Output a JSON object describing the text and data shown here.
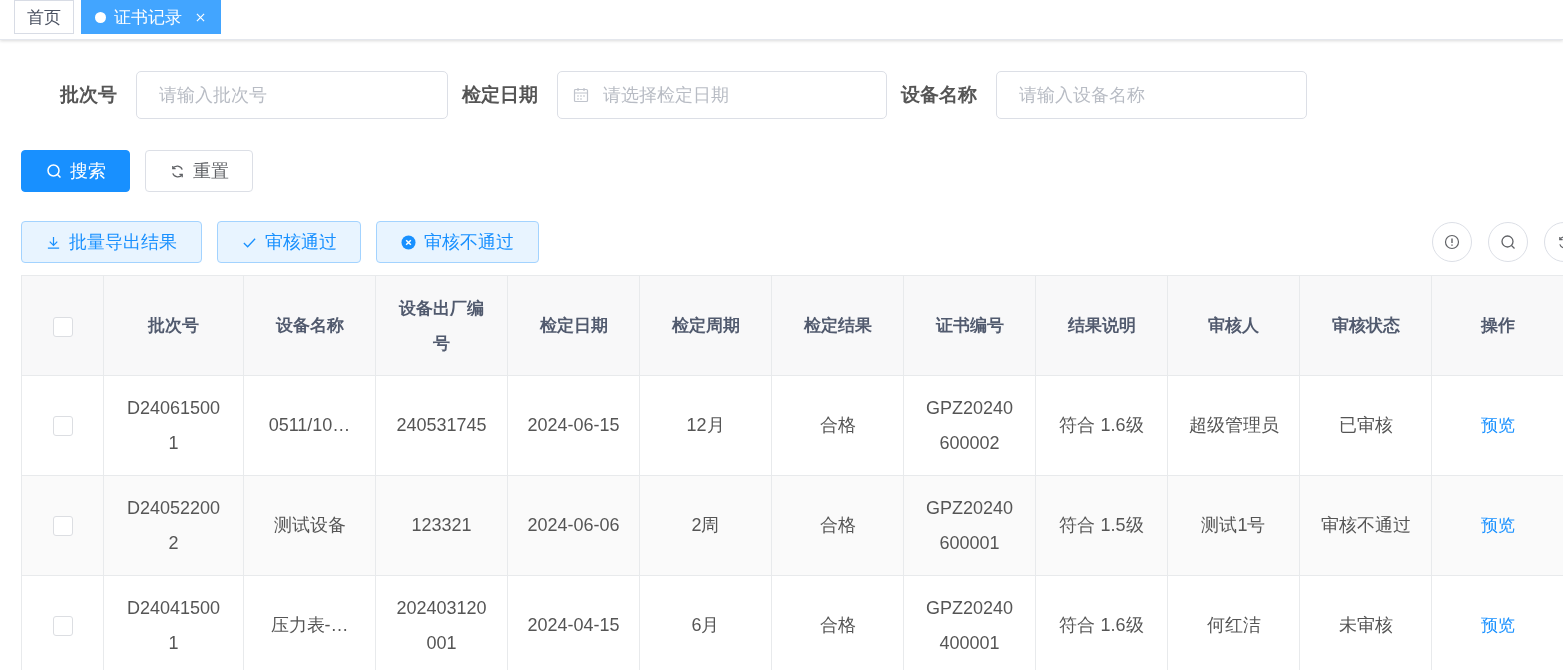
{
  "tabs": [
    {
      "label": "首页",
      "selected": false
    },
    {
      "label": "证书记录",
      "selected": true
    }
  ],
  "filters": [
    {
      "label": "批次号",
      "placeholder": "请输入批次号",
      "kind": "text"
    },
    {
      "label": "检定日期",
      "placeholder": "请选择检定日期",
      "kind": "date"
    },
    {
      "label": "设备名称",
      "placeholder": "请输入设备名称",
      "kind": "text"
    }
  ],
  "form_buttons": [
    {
      "label": "搜索",
      "kind": "search"
    },
    {
      "label": "重置",
      "kind": "reset"
    }
  ],
  "toolbar": [
    {
      "label": "批量导出结果",
      "kind": "export"
    },
    {
      "label": "审核通过",
      "kind": "approve"
    },
    {
      "label": "审核不通过",
      "kind": "reject"
    }
  ],
  "table": {
    "select_all": {
      "checked": false
    },
    "columns": [
      "批次号",
      "设备名称",
      "设备出厂编号",
      "检定日期",
      "检定周期",
      "检定结果",
      "证书编号",
      "结果说明",
      "审核人",
      "审核状态",
      "操作"
    ],
    "rows": [
      {
        "checked": false,
        "cells": [
          "D240615001",
          "0511/10…",
          "240531745",
          "2024-06-15",
          "12月",
          "合格",
          "GPZ20240600002",
          "符合 1.6级",
          "超级管理员",
          "已审核"
        ],
        "action": "预览"
      },
      {
        "checked": false,
        "cells": [
          "D240522002",
          "测试设备",
          "123321",
          "2024-06-06",
          "2周",
          "合格",
          "GPZ20240600001",
          "符合 1.5级",
          "测试1号",
          "审核不通过"
        ],
        "action": "预览"
      },
      {
        "checked": false,
        "cells": [
          "D240415001",
          "压力表-…",
          "202403120001",
          "2024-04-15",
          "6月",
          "合格",
          "GPZ20240400001",
          "符合 1.6级",
          "何红洁",
          "未审核"
        ],
        "action": "预览"
      }
    ]
  }
}
